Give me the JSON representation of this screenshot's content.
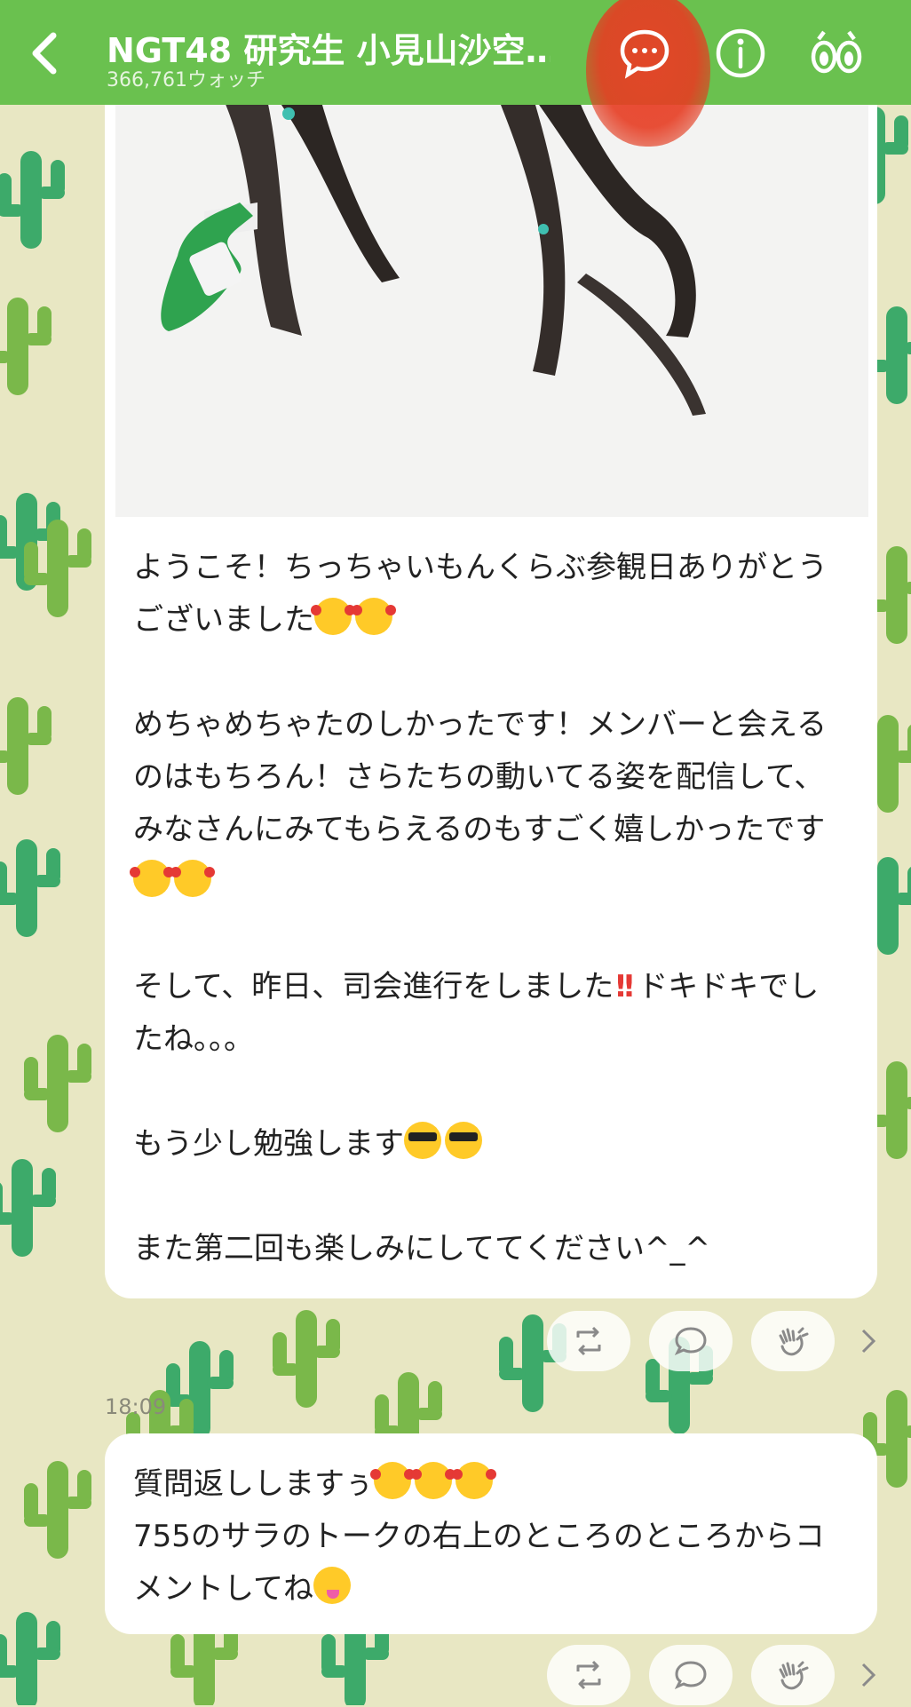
{
  "header": {
    "title": "NGT48 研究生 小見山沙空…",
    "watchers": "366,761ウォッチ"
  },
  "icons": {
    "back": "chevron-left-icon",
    "comment": "chat-bubble-dots-icon",
    "info": "info-icon",
    "watch": "binoculars-icon",
    "retweet": "retweet-icon",
    "reply": "comment-icon",
    "clap": "clap-icon",
    "more": "chevron-right-icon"
  },
  "post1": {
    "line1": "ようこそ！ちっちゃいもんくらぶ参観日ありがとうございました",
    "line2": "めちゃめちゃたのしかったです！メンバーと会えるのはもちろん！さらたちの動いてる姿を配信して、みなさんにみてもらえるのもすごく嬉しかったです",
    "line3a": "そして、昨日、司会進行をしました",
    "line3b": "ドキドキでしたね。。。",
    "line4": "もう少し勉強します",
    "line5": "また第二回も楽しみにしててください^_^"
  },
  "post2": {
    "time": "18:09",
    "line1": "質問返ししますぅ",
    "line2": "755のサラのトークの右上のところのところからコメントしてね"
  },
  "colors": {
    "header": "#6ac14f",
    "background": "#e8e7c3",
    "cactus_dark": "#3daa6a",
    "cactus_light": "#7ab84a",
    "annotation": "#e84026"
  }
}
